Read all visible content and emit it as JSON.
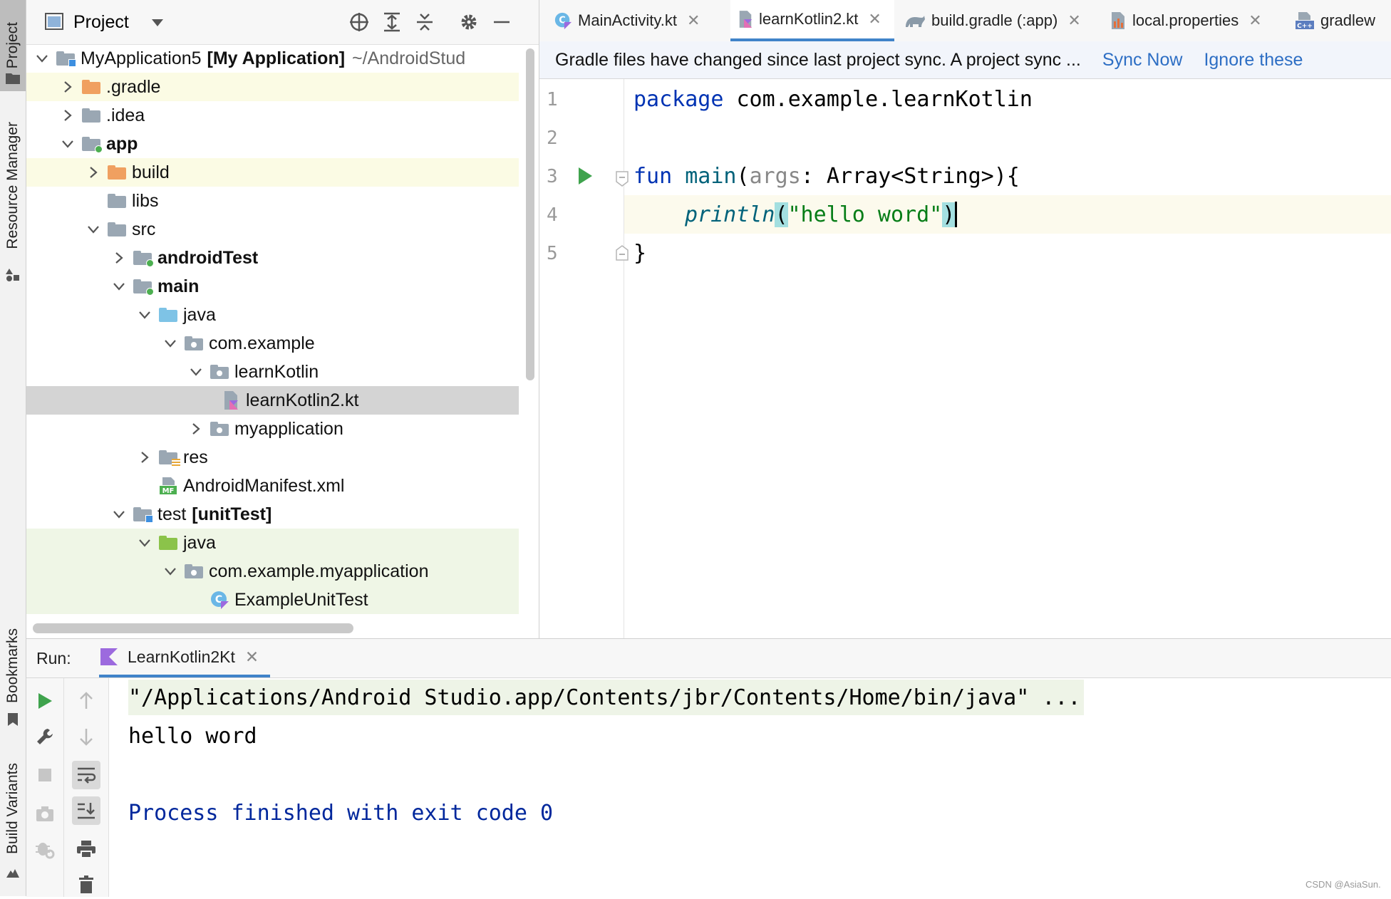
{
  "sidebar": {
    "project_tab": "Project",
    "resource_manager_tab": "Resource Manager",
    "bookmarks_tab": "Bookmarks",
    "build_variants_tab": "Build Variants"
  },
  "project_panel": {
    "title": "Project",
    "tree": [
      {
        "label": "MyApplication5",
        "suffix": "[My Application]",
        "path": "~/AndroidStud",
        "depth": 0,
        "expanded": true,
        "icon": "module-folder-icon"
      },
      {
        "label": ".gradle",
        "depth": 1,
        "expanded": false,
        "icon": "excluded-folder-icon"
      },
      {
        "label": ".idea",
        "depth": 1,
        "expanded": false,
        "icon": "folder-icon"
      },
      {
        "label": "app",
        "depth": 1,
        "expanded": true,
        "icon": "module-folder-icon",
        "bold": true
      },
      {
        "label": "build",
        "depth": 2,
        "expanded": false,
        "icon": "excluded-folder-icon"
      },
      {
        "label": "libs",
        "depth": 2,
        "icon": "folder-icon"
      },
      {
        "label": "src",
        "depth": 2,
        "expanded": true,
        "icon": "folder-icon"
      },
      {
        "label": "androidTest",
        "depth": 3,
        "expanded": false,
        "icon": "module-folder-icon",
        "bold": true
      },
      {
        "label": "main",
        "depth": 3,
        "expanded": true,
        "icon": "module-folder-icon",
        "bold": true
      },
      {
        "label": "java",
        "depth": 4,
        "expanded": true,
        "icon": "source-folder-icon"
      },
      {
        "label": "com.example",
        "depth": 5,
        "expanded": true,
        "icon": "package-icon"
      },
      {
        "label": "learnKotlin",
        "depth": 6,
        "expanded": true,
        "icon": "package-icon"
      },
      {
        "label": "learnKotlin2.kt",
        "depth": 7,
        "icon": "kotlin-file-icon",
        "selected": true
      },
      {
        "label": "myapplication",
        "depth": 6,
        "expanded": false,
        "icon": "package-icon"
      },
      {
        "label": "res",
        "depth": 4,
        "expanded": false,
        "icon": "resource-folder-icon"
      },
      {
        "label": "AndroidManifest.xml",
        "depth": 4,
        "icon": "manifest-file-icon"
      },
      {
        "label": "test",
        "suffix": "[unitTest]",
        "depth": 3,
        "expanded": true,
        "icon": "module-folder-icon"
      },
      {
        "label": "java",
        "depth": 4,
        "expanded": true,
        "icon": "test-folder-icon"
      },
      {
        "label": "com.example.myapplication",
        "depth": 5,
        "expanded": true,
        "icon": "package-icon"
      },
      {
        "label": "ExampleUnitTest",
        "depth": 6,
        "icon": "kotlin-class-icon"
      }
    ]
  },
  "editor_tabs": [
    {
      "label": "MainActivity.kt",
      "icon": "kotlin-class-icon",
      "closable": true
    },
    {
      "label": "learnKotlin2.kt",
      "icon": "kotlin-file-icon",
      "closable": true,
      "active": true
    },
    {
      "label": "build.gradle (:app)",
      "icon": "gradle-icon",
      "closable": true
    },
    {
      "label": "local.properties",
      "icon": "properties-icon",
      "closable": true
    },
    {
      "label": "gradlew",
      "icon": "cpp-file-icon",
      "closable": false
    }
  ],
  "banner": {
    "message": "Gradle files have changed since last project sync. A project sync ...",
    "sync_now": "Sync Now",
    "ignore": "Ignore these"
  },
  "editor": {
    "line_numbers": [
      "1",
      "2",
      "3",
      "4",
      "5"
    ],
    "line1_kw": "package",
    "line1_rest": " com.example.learnKotlin",
    "line3_kw": "fun",
    "line3_fn": "main",
    "line3_open": "(",
    "line3_param": "args",
    "line3_rest": ": Array<String>){",
    "line4_fn": "println",
    "line4_open": "(",
    "line4_str": "\"hello word\"",
    "line4_close": ")",
    "line5": "}"
  },
  "run_panel": {
    "label": "Run:",
    "tab_label": "LearnKotlin2Kt",
    "console": {
      "command": "\"/Applications/Android Studio.app/Contents/jbr/Contents/Home/bin/java\" ...",
      "output": "hello word",
      "finished": "Process finished with exit code 0"
    }
  },
  "watermark": "CSDN @AsiaSun."
}
